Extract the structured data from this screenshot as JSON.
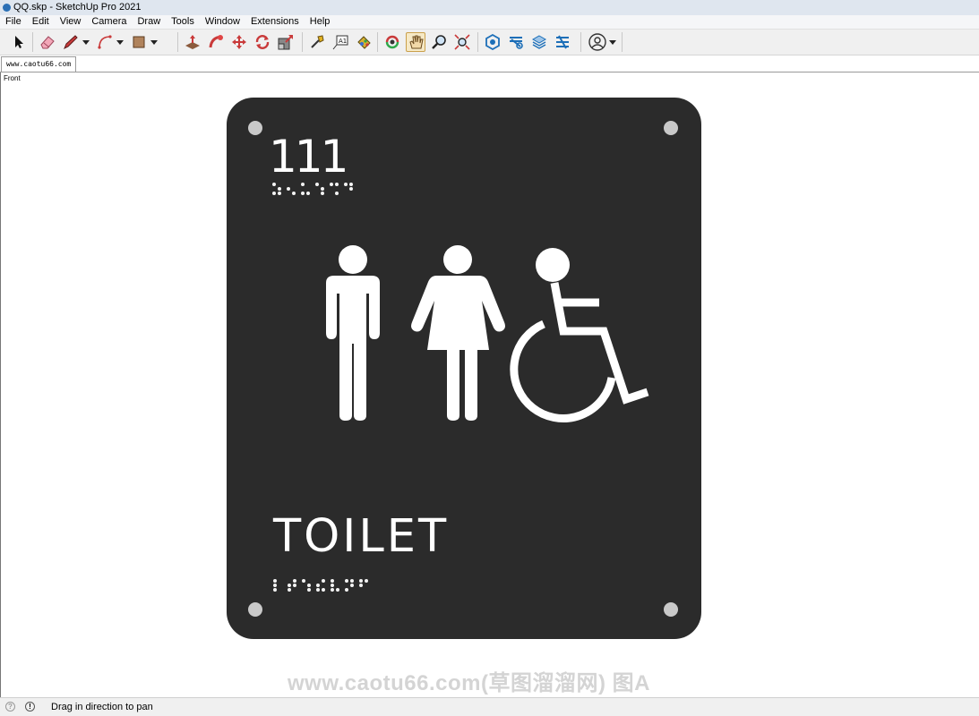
{
  "window": {
    "title": "QQ.skp - SketchUp Pro 2021"
  },
  "menu": [
    "File",
    "Edit",
    "View",
    "Camera",
    "Draw",
    "Tools",
    "Window",
    "Extensions",
    "Help"
  ],
  "toolbar": {
    "tools": [
      "select-tool",
      "eraser-tool",
      "line-tool",
      "arc-tool",
      "shape-tool",
      "push-pull-tool",
      "follow-me-tool",
      "move-tool",
      "rotate-tool",
      "scale-tool",
      "tape-measure-tool",
      "text-tool",
      "paint-bucket-tool",
      "orbit-tool",
      "pan-tool",
      "zoom-tool",
      "zoom-extents-tool",
      "3d-warehouse",
      "extension-warehouse",
      "layout",
      "extension-manager",
      "account"
    ]
  },
  "tab": {
    "label": "www.caotu66.com"
  },
  "viewport": {
    "scene_label": "Front"
  },
  "sign": {
    "room_number": "111",
    "room_text": "TOILET",
    "colors": {
      "plate": "#2b2b2b",
      "text": "#ffffff",
      "screw": "#c9c9c9"
    }
  },
  "watermark": {
    "text": "www.caotu66.com(草图溜溜网) 图A"
  },
  "status": {
    "message": "Drag in direction to pan"
  }
}
